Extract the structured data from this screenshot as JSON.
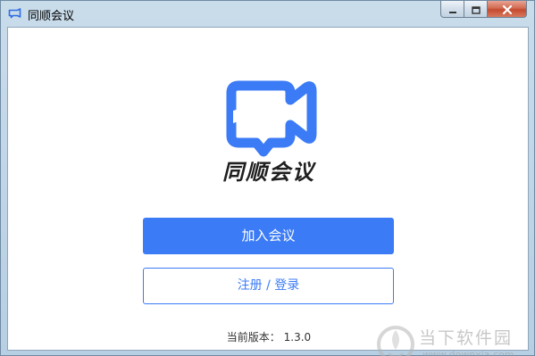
{
  "window": {
    "title": "同顺会议",
    "icon": "camera-chat-icon",
    "controls": [
      "minimize-icon",
      "maximize-icon",
      "close-icon"
    ]
  },
  "app": {
    "brand_name": "同顺会议",
    "logo": "video-camera-chat-logo",
    "join_button": "加入会议",
    "login_button": "注册 / 登录",
    "version_label": "当前版本：",
    "version_value": "1.3.0"
  },
  "watermark": {
    "name": "当下软件园",
    "url": "www.downxia.com"
  },
  "colors": {
    "accent": "#3b7bf5",
    "brand_text": "#1f1f1f",
    "titlebar": "#c9dcea"
  }
}
